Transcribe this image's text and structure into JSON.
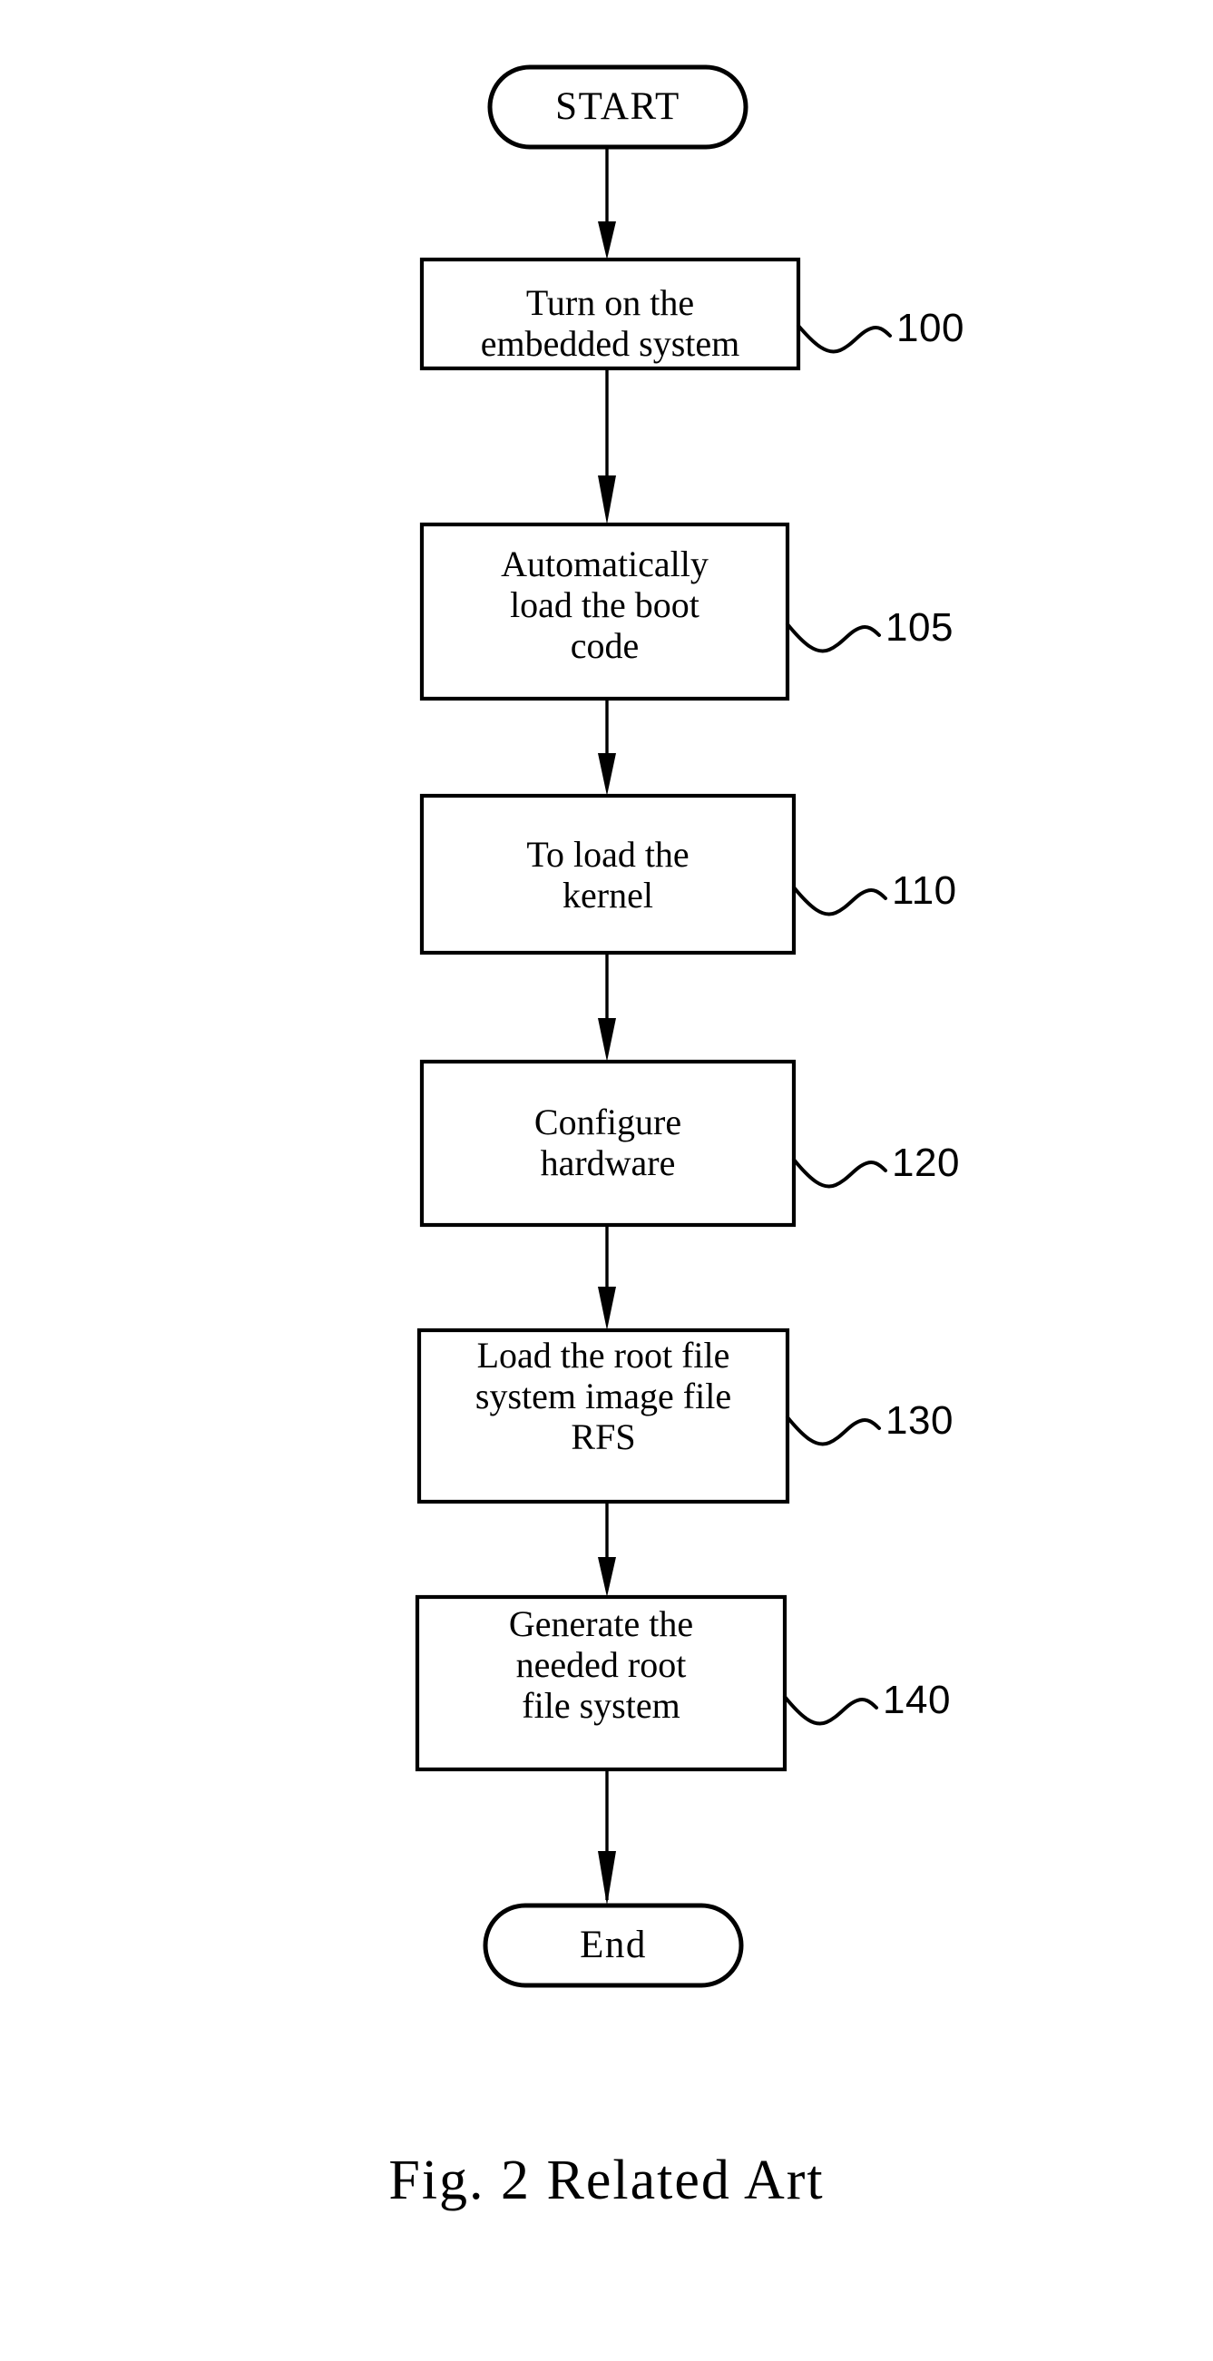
{
  "figure": {
    "caption": "Fig. 2 Related Art",
    "title": "Flowchart of embedded system boot sequence (Related Art)",
    "ink_color": "#000000",
    "background_color": "#ffffff"
  },
  "nodes": {
    "start": {
      "label": "START",
      "shape": "terminator"
    },
    "step_100": {
      "lines": [
        "Turn on the",
        "embedded system"
      ],
      "ref": "100",
      "shape": "process"
    },
    "step_105": {
      "lines": [
        "Automatically",
        "load the boot",
        "code"
      ],
      "ref": "105",
      "shape": "process"
    },
    "step_110": {
      "lines": [
        "To load the",
        "kernel"
      ],
      "ref": "110",
      "shape": "process"
    },
    "step_120": {
      "lines": [
        "Configure",
        "hardware"
      ],
      "ref": "120",
      "shape": "process"
    },
    "step_130": {
      "lines": [
        "Load the root file",
        "system image file",
        "RFS"
      ],
      "ref": "130",
      "shape": "process"
    },
    "step_140": {
      "lines": [
        "Generate the",
        "needed root",
        "file system"
      ],
      "ref": "140",
      "shape": "process"
    },
    "end": {
      "label": "End",
      "shape": "terminator"
    }
  },
  "text": {
    "start_label": "START",
    "end_label": "End",
    "s100_l1": "Turn on the",
    "s100_l2": "embedded system",
    "s105_l1": "Automatically",
    "s105_l2": "load the boot",
    "s105_l3": "code",
    "s110_l1": "To load the",
    "s110_l2": "kernel",
    "s120_l1": "Configure",
    "s120_l2": "hardware",
    "s130_l1": "Load the root file",
    "s130_l2": "system image file",
    "s130_l3": "RFS",
    "s140_l1": "Generate the",
    "s140_l2": "needed root",
    "s140_l3": "file system",
    "ref_100": "100",
    "ref_105": "105",
    "ref_110": "110",
    "ref_120": "120",
    "ref_130": "130",
    "ref_140": "140",
    "caption": "Fig. 2 Related Art"
  },
  "flow": {
    "sequence": [
      "START",
      "100",
      "105",
      "110",
      "120",
      "130",
      "140",
      "End"
    ],
    "connector_type": "vertical-arrow",
    "arrow_count": 7
  }
}
